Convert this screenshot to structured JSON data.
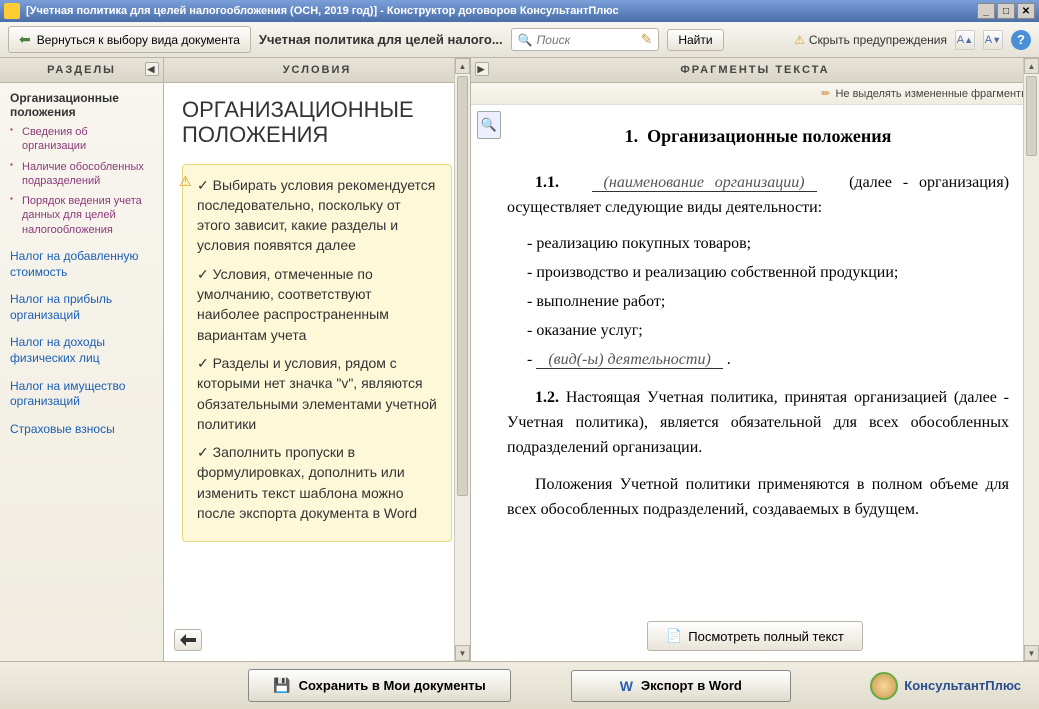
{
  "titlebar": {
    "title": "[Учетная политика для целей налогообложения (ОСН, 2019 год)] - Конструктор договоров КонсультантПлюс"
  },
  "toolbar": {
    "back_label": "Вернуться к выбору вида документа",
    "doc_title": "Учетная политика для целей налого...",
    "search_placeholder": "Поиск",
    "find_label": "Найти",
    "hide_warnings": "Скрыть предупреждения"
  },
  "sidebar": {
    "header": "РАЗДЕЛЫ",
    "active_section": "Организационные положения",
    "subitems": [
      "Сведения об организации",
      "Наличие обособленных подразделений",
      "Порядок ведения учета данных для целей налогообложения"
    ],
    "links": [
      "Налог на добавленную стоимость",
      "Налог на прибыль организаций",
      "Налог на доходы физических лиц",
      "Налог на имущество организаций",
      "Страховые взносы"
    ]
  },
  "conditions": {
    "header": "УСЛОВИЯ",
    "title": "ОРГАНИЗАЦИОННЫЕ ПОЛОЖЕНИЯ",
    "tips": [
      "✓ Выбирать условия рекомендуется последовательно, поскольку от этого зависит, какие разделы и условия появятся далее",
      "✓ Условия, отмеченные по умолчанию, соответствуют наиболее распространенным вариантам учета",
      "✓ Разделы и условия, рядом с которыми нет значка \"v\", являются обязательными элементами учетной политики",
      "✓ Заполнить пропуски в формулировках, дополнить или изменить текст шаблона можно после экспорта документа в Word"
    ]
  },
  "fragments": {
    "header": "ФРАГМЕНТЫ ТЕКСТА",
    "subbar": "Не выделять измененные фрагменты",
    "title_num": "1.",
    "title_text": "Организационные положения",
    "p11_num": "1.1.",
    "p11_blank": "(наименование организации)",
    "p11_after": "(далее - организация) осуществляет следующие виды деятельности:",
    "list": [
      "- реализацию покупных товаров;",
      "- производство и реализацию собственной продукции;",
      "- выполнение работ;",
      "- оказание услуг;"
    ],
    "list_blank_prefix": "- ",
    "list_blank": "(вид(-ы) деятельности)",
    "list_blank_suffix": ".",
    "p12": "1.2. Настоящая Учетная политика, принятая организацией (далее - Учетная политика), является обязательной для всех обособленных подразделений организации.",
    "p_future": "Положения Учетной политики применяются в полном объеме для всех обособленных подразделений, создаваемых в будущем.",
    "view_full": "Посмотреть полный текст"
  },
  "bottom": {
    "save": "Сохранить в Мои документы",
    "export": "Экспорт в Word",
    "brand": "КонсультантПлюс"
  }
}
